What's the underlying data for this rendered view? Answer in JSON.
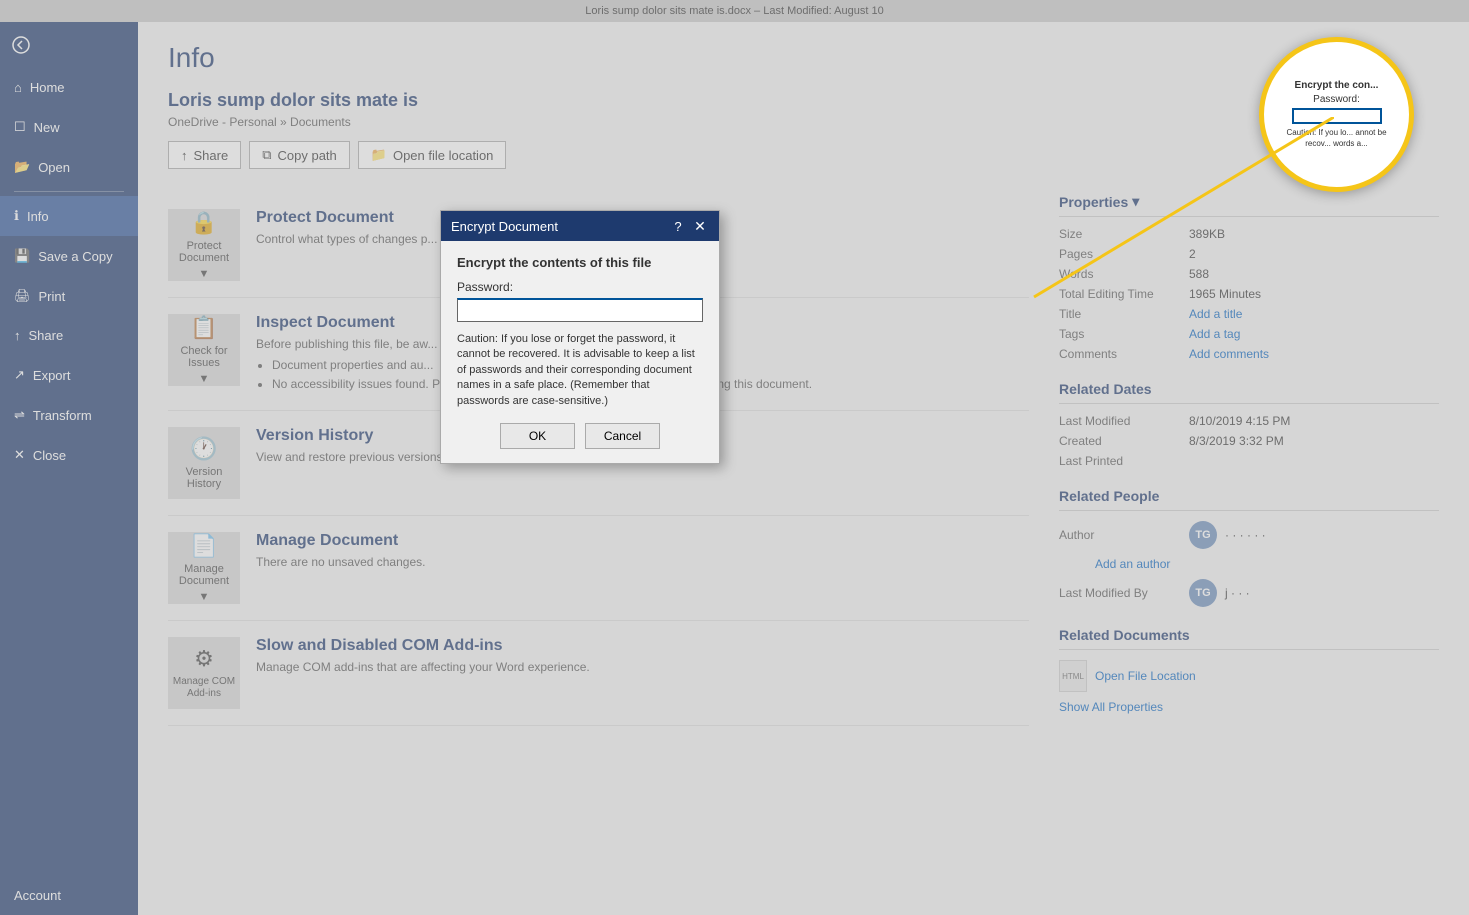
{
  "topBar": {
    "docName": "Loris sump dolor sits mate is.docx",
    "separator": "–",
    "lastModified": "Last Modified: August 10"
  },
  "sidebar": {
    "backLabel": "",
    "items": [
      {
        "id": "home",
        "label": "Home",
        "icon": "home-icon"
      },
      {
        "id": "new",
        "label": "New",
        "icon": "new-icon"
      },
      {
        "id": "open",
        "label": "Open",
        "icon": "open-icon"
      },
      {
        "id": "info",
        "label": "Info",
        "icon": "info-icon",
        "active": true
      },
      {
        "id": "save-a-copy",
        "label": "Save a Copy",
        "icon": "save-copy-icon"
      },
      {
        "id": "print",
        "label": "Print",
        "icon": "print-icon"
      },
      {
        "id": "share",
        "label": "Share",
        "icon": "share-icon"
      },
      {
        "id": "export",
        "label": "Export",
        "icon": "export-icon"
      },
      {
        "id": "transform",
        "label": "Transform",
        "icon": "transform-icon"
      },
      {
        "id": "close",
        "label": "Close",
        "icon": "close-nav-icon"
      }
    ],
    "accountLabel": "Account"
  },
  "content": {
    "pageTitle": "Info",
    "docTitle": "Loris sump dolor sits mate is",
    "docPath": "OneDrive - Personal » Documents",
    "actions": [
      {
        "id": "share",
        "label": "Share",
        "icon": "share-btn-icon"
      },
      {
        "id": "copy-path",
        "label": "Copy path",
        "icon": "copy-path-icon"
      },
      {
        "id": "open-file-location",
        "label": "Open file location",
        "icon": "folder-icon"
      }
    ],
    "sections": [
      {
        "id": "protect-document",
        "iconLabel": "Protect Document",
        "iconSub": "▼",
        "title": "Protect Document",
        "desc": "Control what types of changes p..."
      },
      {
        "id": "inspect-document",
        "iconLabel": "Check for Issues",
        "iconSub": "▼",
        "title": "Inspect Document",
        "desc": "Before publishing this file, be aw...",
        "bullets": [
          "Document properties and au...",
          "No accessibility issues found. People with disabilities should not have difficulty reading this document."
        ]
      },
      {
        "id": "version-history",
        "iconLabel": "Version History",
        "title": "Version History",
        "desc": "View and restore previous versions."
      },
      {
        "id": "manage-document",
        "iconLabel": "Manage Document",
        "iconSub": "▼",
        "title": "Manage Document",
        "desc": "There are no unsaved changes."
      },
      {
        "id": "com-addins",
        "iconLabel": "Manage COM Add-ins",
        "title": "Slow and Disabled COM Add-ins",
        "desc": "Manage COM add-ins that are affecting your Word experience."
      }
    ]
  },
  "properties": {
    "panelTitle": "Properties",
    "panelTitleArrow": "▾",
    "rows": [
      {
        "label": "Size",
        "value": "389KB"
      },
      {
        "label": "Pages",
        "value": "2"
      },
      {
        "label": "Words",
        "value": "588"
      },
      {
        "label": "Total Editing Time",
        "value": "1965 Minutes"
      },
      {
        "label": "Title",
        "value": "Add a title",
        "isLink": true
      },
      {
        "label": "Tags",
        "value": "Add a tag",
        "isLink": true
      },
      {
        "label": "Comments",
        "value": "Add comments",
        "isLink": true
      }
    ],
    "relatedDates": {
      "title": "Related Dates",
      "rows": [
        {
          "label": "Last Modified",
          "value": "8/10/2019 4:15 PM"
        },
        {
          "label": "Created",
          "value": "8/3/2019 3:32 PM"
        },
        {
          "label": "Last Printed",
          "value": ""
        }
      ]
    },
    "relatedPeople": {
      "title": "Related People",
      "author": {
        "label": "Author",
        "avatar": "TG",
        "name": "· · · · · ·"
      },
      "addAuthor": "Add an author",
      "lastModifiedBy": {
        "label": "Last Modified By",
        "avatar": "TG",
        "name": "j · · ·"
      }
    },
    "relatedDocuments": {
      "title": "Related Documents",
      "openFileLocation": "Open File Location",
      "showAllProperties": "Show All Properties"
    }
  },
  "dialog": {
    "title": "Encrypt Document",
    "helpTooltip": "?",
    "bodyTitle": "Encrypt the contents of this file",
    "passwordLabel": "Password:",
    "cautionText": "Caution: If you lose or forget the password, it cannot be recovered. It is advisable to keep a list of passwords and their corresponding document names in a safe place.\n(Remember that passwords are case-sensitive.)",
    "okLabel": "OK",
    "cancelLabel": "Cancel"
  },
  "zoomCallout": {
    "title": "Encrypt the con...",
    "passwordLabel": "Password:",
    "cautionText": "Caution: If you lo... annot be recov... words a..."
  }
}
